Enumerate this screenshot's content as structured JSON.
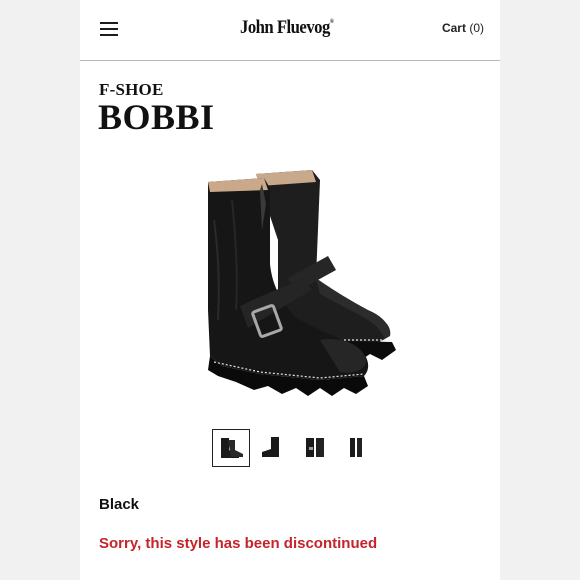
{
  "header": {
    "menu_icon": "hamburger-menu-icon",
    "logo": "John Fluevog",
    "logo_mark": "®",
    "cart_label": "Cart",
    "cart_count": "(0)"
  },
  "product": {
    "category": "F-SHOE",
    "name": "BOBBI",
    "color": "Black",
    "status": "Sorry, this style has been discontinued",
    "thumbnails": [
      "pair-angle",
      "side-view",
      "pair-front",
      "pair-back"
    ],
    "selected_thumbnail": 0
  },
  "colors": {
    "status_red": "#c4242b",
    "text": "#111111",
    "divider": "#b9b9b9"
  }
}
